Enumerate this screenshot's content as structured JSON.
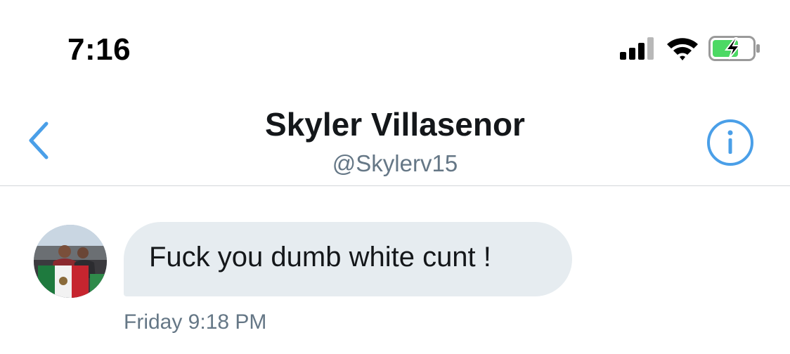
{
  "status_bar": {
    "time": "7:16",
    "signal_icon": "cellular-signal-icon",
    "wifi_icon": "wifi-icon",
    "battery_icon": "battery-charging-icon",
    "battery_color": "#4cd964"
  },
  "header": {
    "back_icon": "chevron-left-icon",
    "name": "Skyler Villasenor",
    "handle": "@Skylerv15",
    "info_icon": "info-icon",
    "accent_color": "#4a9fe8"
  },
  "conversation": {
    "messages": [
      {
        "avatar_icon": "avatar-photo",
        "text": "Fuck you dumb white cunt !",
        "timestamp": "Friday 9:18 PM",
        "bubble_color": "#e6ecf0"
      }
    ]
  }
}
